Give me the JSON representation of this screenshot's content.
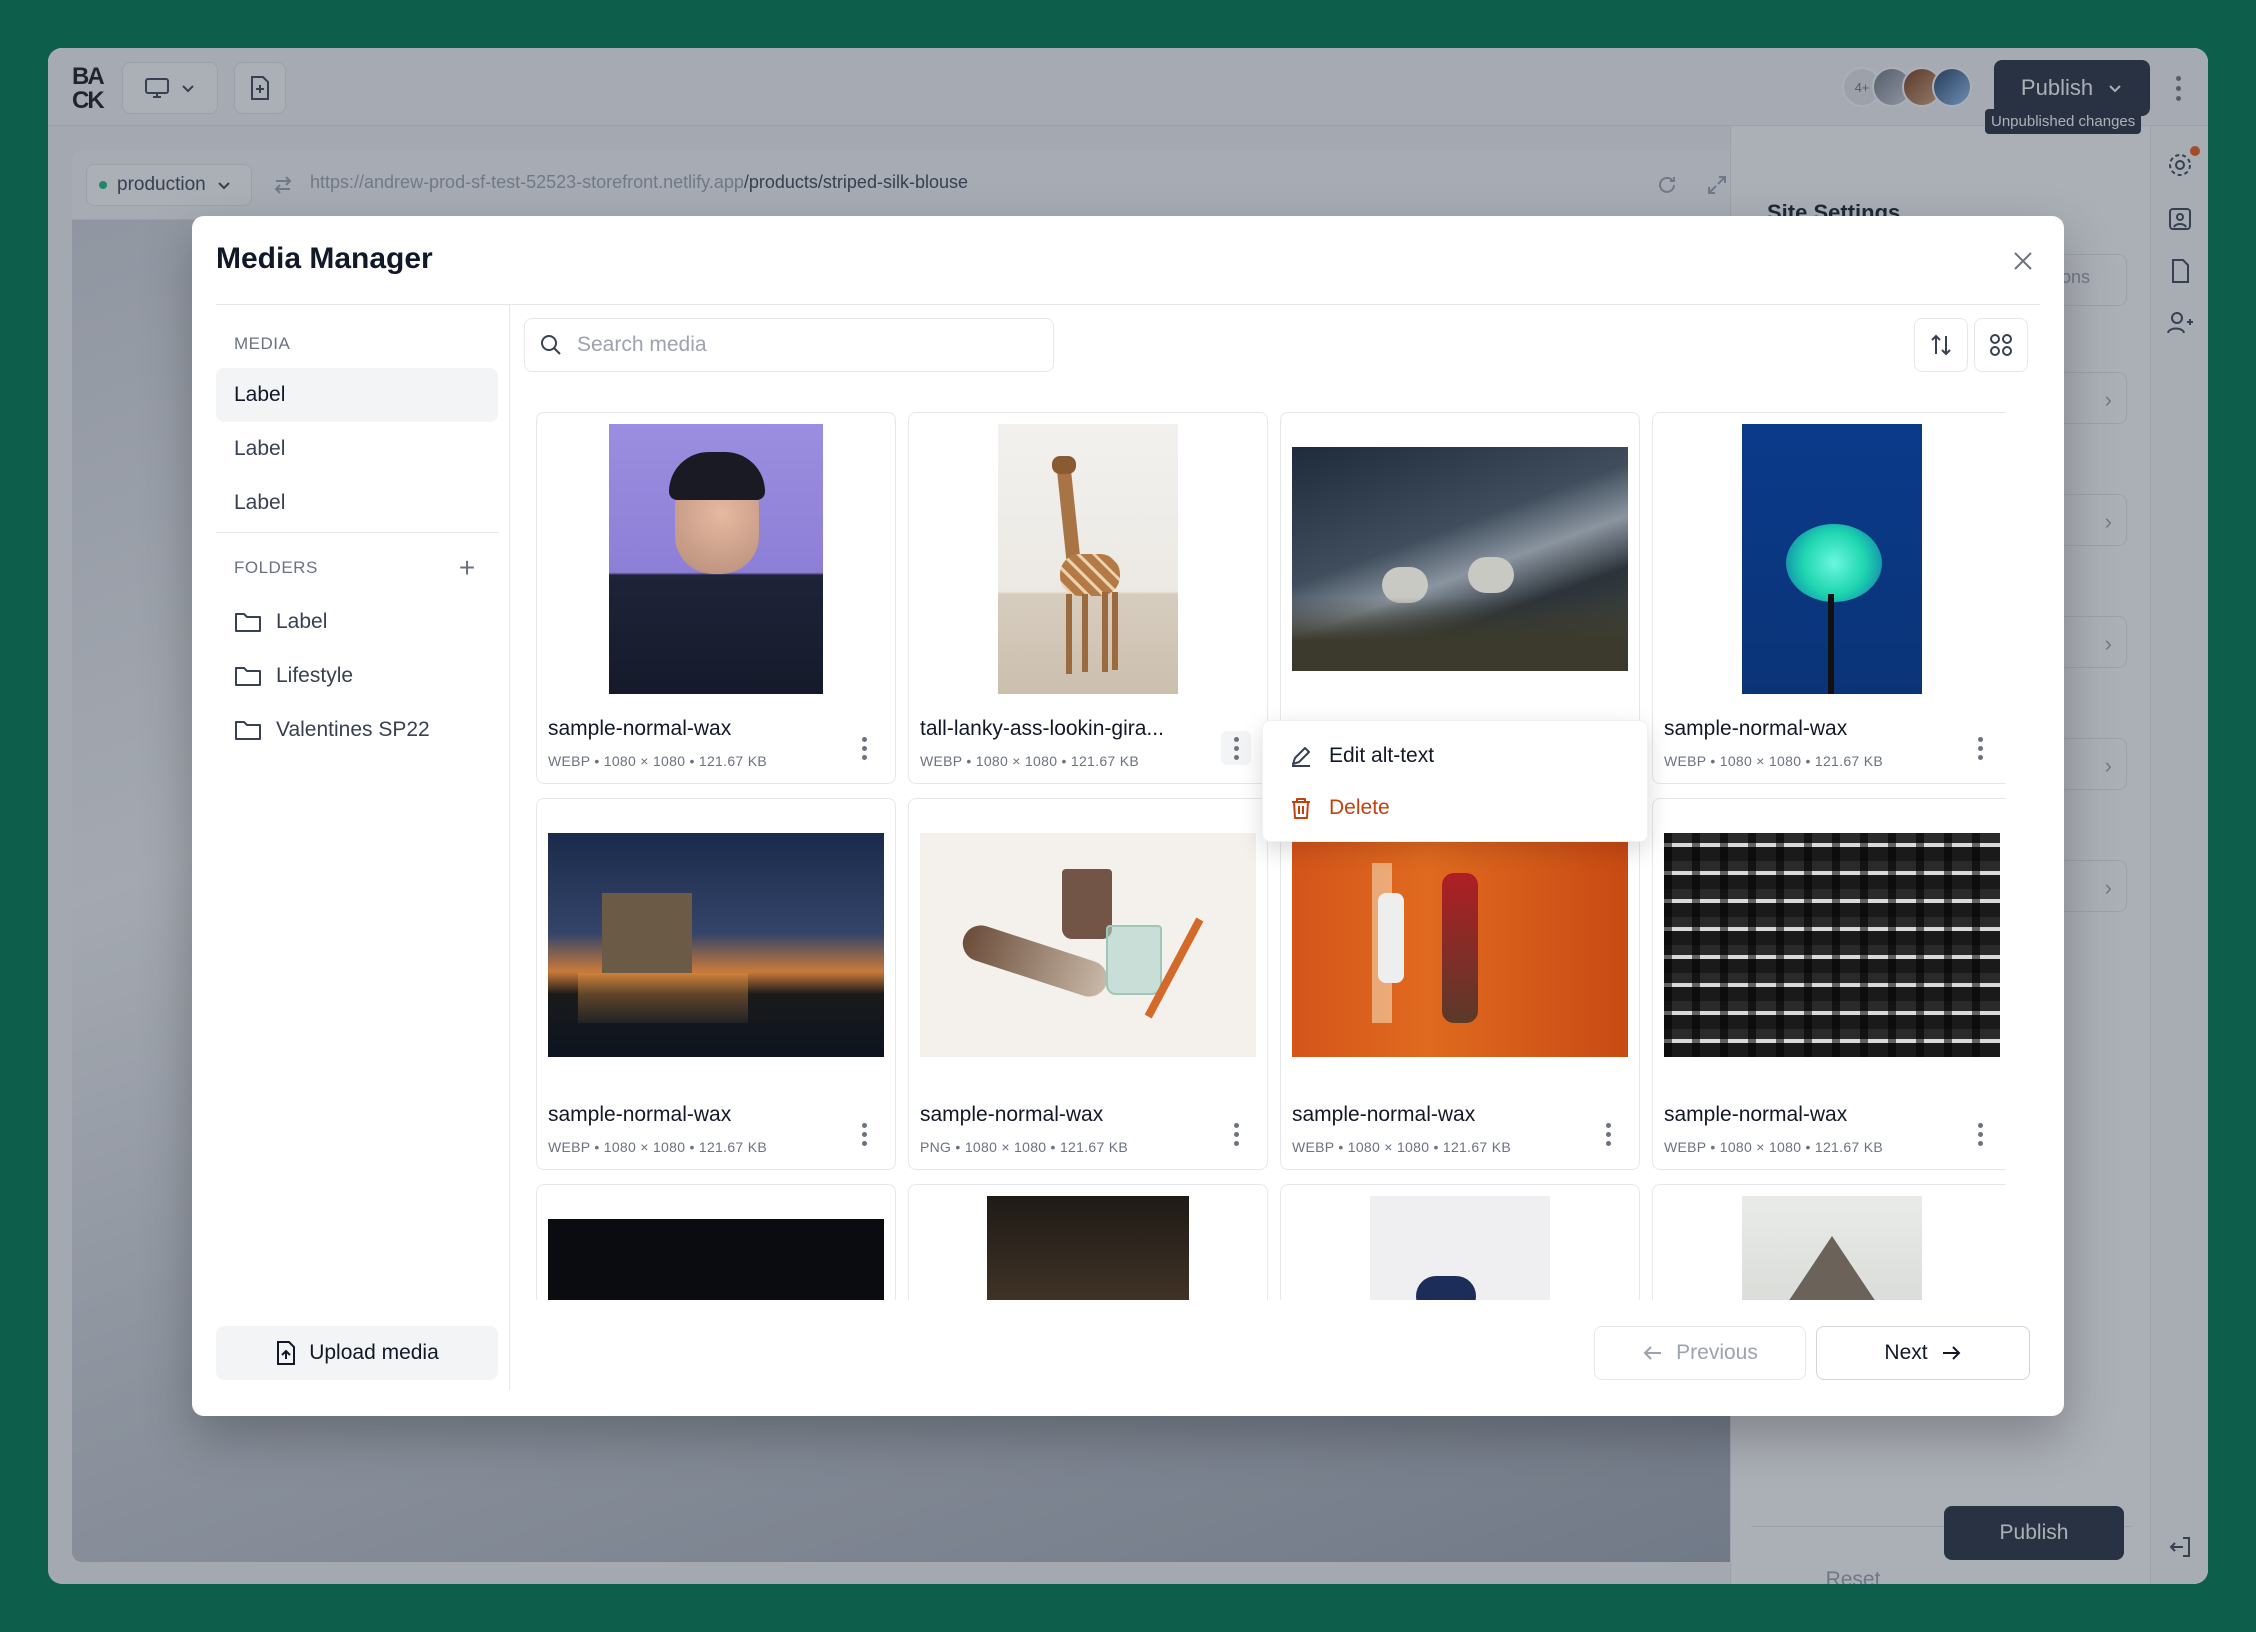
{
  "app": {
    "logo_text": "BACK",
    "avatars_more": "4+",
    "publish_label": "Publish",
    "env_label": "production",
    "url_base": "https://andrew-prod-sf-test-52523-storefront.netlify.app",
    "url_path": "/products/striped-silk-blouse",
    "settings_title": "Site Settings",
    "unpublished_label": "Unpublished changes",
    "settings_partial_text": "ons",
    "reset_label": "Reset",
    "publish_bottom_label": "Publish",
    "accent_dark": "#1f2937",
    "notice_color": "#ea580c"
  },
  "modal": {
    "title": "Media Manager",
    "sidebar": {
      "media_heading": "MEDIA",
      "media_items": [
        {
          "label": "Label",
          "active": true
        },
        {
          "label": "Label",
          "active": false
        },
        {
          "label": "Label",
          "active": false
        }
      ],
      "folders_heading": "FOLDERS",
      "folders": [
        {
          "label": "Label"
        },
        {
          "label": "Lifestyle"
        },
        {
          "label": "Valentines SP22"
        }
      ],
      "upload_label": "Upload media"
    },
    "search": {
      "placeholder": "Search media",
      "value": ""
    },
    "media": [
      {
        "name": "sample-normal-wax",
        "meta": "WEBP • 1080 × 1080 • 121.67 KB",
        "thumb": "portrait-woman"
      },
      {
        "name": "tall-lanky-ass-lookin-gira...",
        "meta": "WEBP • 1080 × 1080 • 121.67 KB",
        "thumb": "giraffe"
      },
      {
        "name": "",
        "meta": "",
        "thumb": "sneakers-cliff"
      },
      {
        "name": "sample-normal-wax",
        "meta": "WEBP • 1080 × 1080 • 121.67 KB",
        "thumb": "neon-flower"
      },
      {
        "name": "sample-normal-wax",
        "meta": "WEBP • 1080 × 1080 • 121.67 KB",
        "thumb": "castle-star-trails"
      },
      {
        "name": "sample-normal-wax",
        "meta": "PNG • 1080 × 1080 • 121.67 KB",
        "thumb": "glassware"
      },
      {
        "name": "sample-normal-wax",
        "meta": "WEBP • 1080 × 1080 • 121.67 KB",
        "thumb": "orange-room"
      },
      {
        "name": "sample-normal-wax",
        "meta": "WEBP • 1080 × 1080 • 121.67 KB",
        "thumb": "building-windows"
      },
      {
        "name": "",
        "meta": "",
        "thumb": "night-sky"
      },
      {
        "name": "",
        "meta": "",
        "thumb": "dark-interior"
      },
      {
        "name": "",
        "meta": "",
        "thumb": "pale-figure"
      },
      {
        "name": "",
        "meta": "",
        "thumb": "mountain-peak"
      }
    ],
    "context_menu": {
      "edit_label": "Edit alt-text",
      "delete_label": "Delete",
      "delete_color": "#c2410c"
    },
    "pagination": {
      "previous_label": "Previous",
      "next_label": "Next"
    }
  }
}
